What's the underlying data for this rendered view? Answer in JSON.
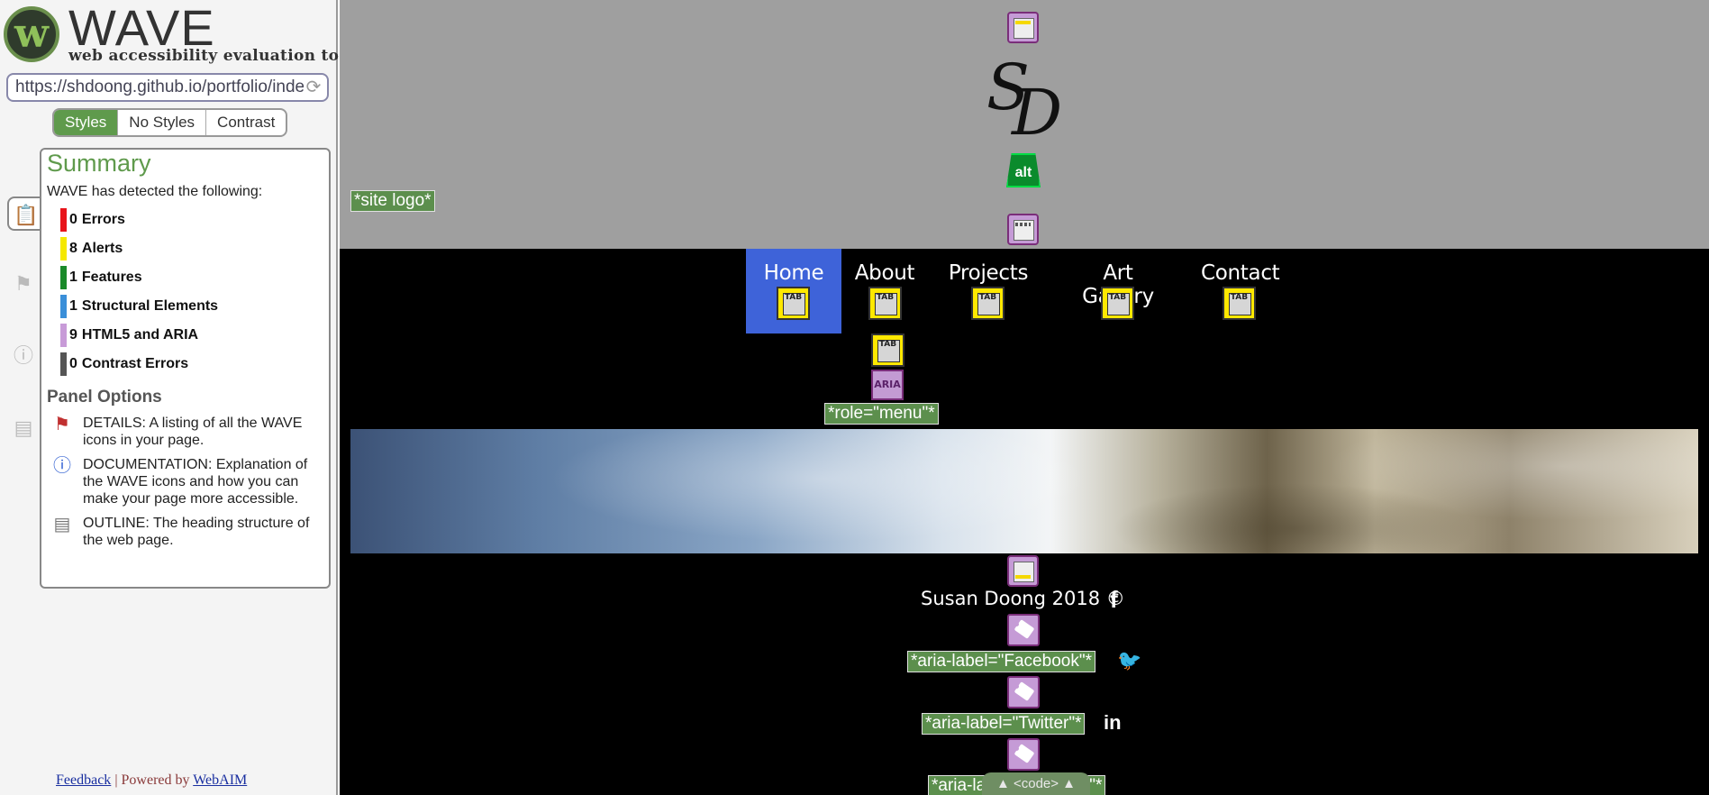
{
  "wave": {
    "logo_title": "WAVE",
    "logo_subtitle": "web accessibility evaluation tool",
    "url": "https://shdoong.github.io/portfolio/index.html",
    "style_toggle": [
      "Styles",
      "No Styles",
      "Contrast"
    ],
    "summary": {
      "title": "Summary",
      "intro": "WAVE has detected the following:",
      "counts": [
        {
          "num": "0",
          "label": "Errors",
          "color": "#e8141a"
        },
        {
          "num": "8",
          "label": "Alerts",
          "color": "#f5e800"
        },
        {
          "num": "1",
          "label": "Features",
          "color": "#1a8a2a"
        },
        {
          "num": "1",
          "label": "Structural Elements",
          "color": "#3a8fd9"
        },
        {
          "num": "9",
          "label": "HTML5 and ARIA",
          "color": "#c89bd8"
        },
        {
          "num": "0",
          "label": "Contrast Errors",
          "color": "#555555"
        }
      ],
      "panel_options_title": "Panel Options",
      "options": [
        {
          "icon": "details-flag-icon",
          "text": "DETAILS: A listing of all the WAVE icons in your page."
        },
        {
          "icon": "info-icon",
          "text": "DOCUMENTATION: Explanation of the WAVE icons and how you can make your page more accessible."
        },
        {
          "icon": "outline-document-icon",
          "text": "OUTLINE: The heading structure of the web page."
        }
      ]
    },
    "footer": {
      "feedback": "Feedback",
      "separator": " | Powered by ",
      "webaim": "WebAIM"
    }
  },
  "page": {
    "site_logo_label": "*site logo*",
    "alt_icon_text": "alt",
    "nav": [
      "Home",
      "About",
      "Projects",
      "Art Gallery",
      "Contact"
    ],
    "tab_icon_text": "TAB",
    "aria_icon_text": "ARIA",
    "role_menu_label": "*role=\"menu\"*",
    "copyright": "Susan Doong 2018 ©",
    "aria_labels": [
      "*aria-label=\"Facebook\"*",
      "*aria-label=\"Twitter\"*",
      "*aria-label=\"LinkedIn\"*"
    ],
    "code_toggle": "▲ <code> ▲"
  }
}
